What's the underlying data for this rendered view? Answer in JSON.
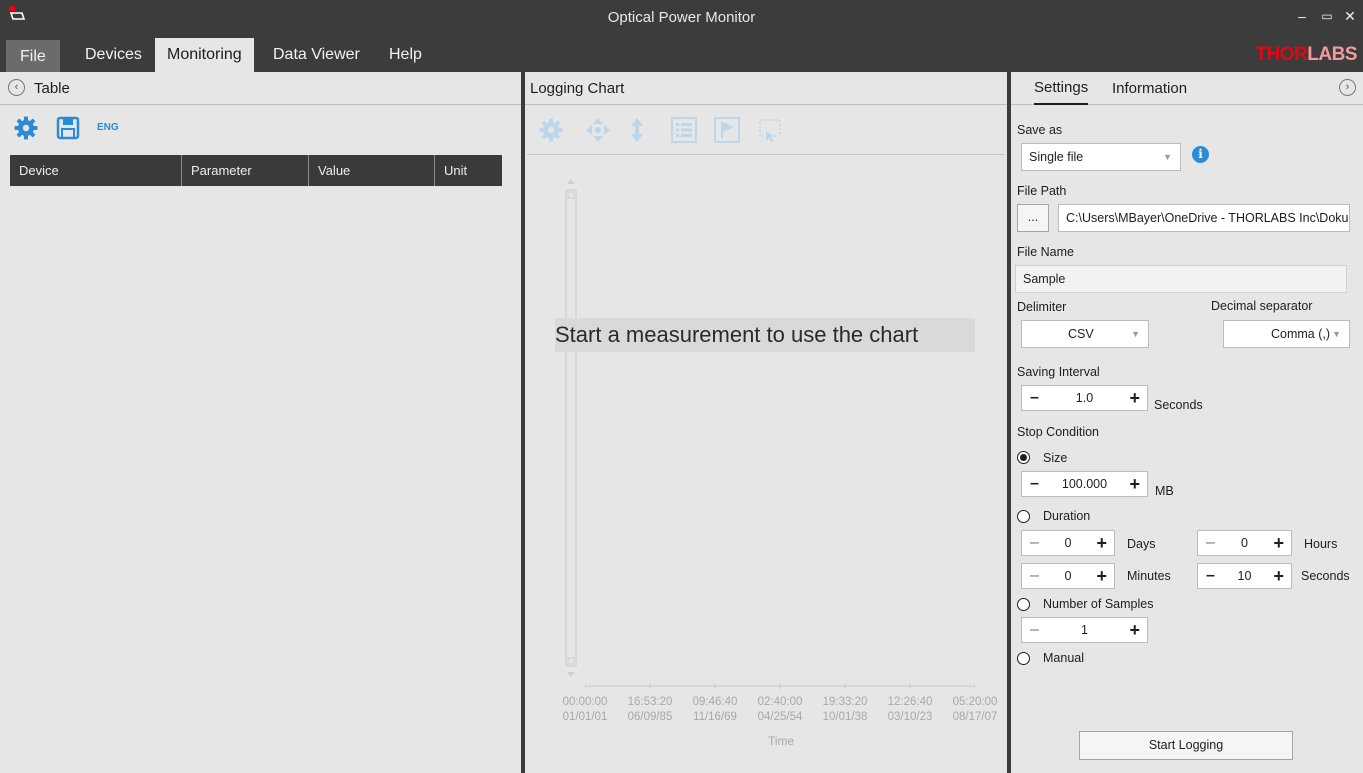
{
  "window": {
    "title": "Optical Power Monitor",
    "minimize": "–",
    "maximize": "▭",
    "close": "✕"
  },
  "menu": {
    "file": "File",
    "devices": "Devices",
    "monitoring": "Monitoring",
    "data_viewer": "Data Viewer",
    "help": "Help"
  },
  "brand": {
    "logo_part1": "THOR",
    "logo_part2": "LABS",
    "color_red": "#e30613"
  },
  "left_panel": {
    "title": "Table",
    "toolbar": {
      "language": "ENG",
      "icons": [
        "gear-icon",
        "save-icon"
      ]
    },
    "columns": [
      "Device",
      "Parameter",
      "Value",
      "Unit"
    ]
  },
  "chart_panel": {
    "title": "Logging Chart",
    "message": "Start a measurement to use the chart",
    "toolbar_icons": [
      "gear-icon",
      "move-icon",
      "vertical-resize-icon",
      "list-icon",
      "flag-icon",
      "select-region-icon"
    ]
  },
  "chart_data": {
    "type": "line",
    "xlabel": "Time",
    "x_tick_labels": [
      [
        "00:00:00",
        "01/01/01"
      ],
      [
        "16:53:20",
        "06/09/85"
      ],
      [
        "09:46:40",
        "11/16/69"
      ],
      [
        "02:40:00",
        "04/25/54"
      ],
      [
        "19:33:20",
        "10/01/38"
      ],
      [
        "12:26:40",
        "03/10/23"
      ],
      [
        "05:20:00",
        "08/17/07"
      ]
    ],
    "series": []
  },
  "settings": {
    "tabs": [
      "Settings",
      "Information"
    ],
    "save_as_label": "Save as",
    "save_as_value": "Single file",
    "file_path_label": "File Path",
    "browse_button": "...",
    "file_path_value": "C:\\Users\\MBayer\\OneDrive - THORLABS Inc\\Doku",
    "file_name_label": "File Name",
    "file_name_value": "Sample",
    "delimiter_label": "Delimiter",
    "delimiter_value": "CSV",
    "decimal_label": "Decimal separator",
    "decimal_value": "Comma (,)",
    "interval_label": "Saving Interval",
    "interval_value": "1.0",
    "interval_unit": "Seconds",
    "stop_label": "Stop Condition",
    "size_label": "Size",
    "size_value": "100.000",
    "size_unit": "MB",
    "duration_label": "Duration",
    "days_value": "0",
    "days_unit": "Days",
    "hours_value": "0",
    "hours_unit": "Hours",
    "minutes_value": "0",
    "minutes_unit": "Minutes",
    "seconds_value": "10",
    "seconds_unit": "Seconds",
    "samples_label": "Number of Samples",
    "samples_value": "1",
    "manual_label": "Manual",
    "stop_selected": "Size",
    "start_button": "Start Logging"
  }
}
